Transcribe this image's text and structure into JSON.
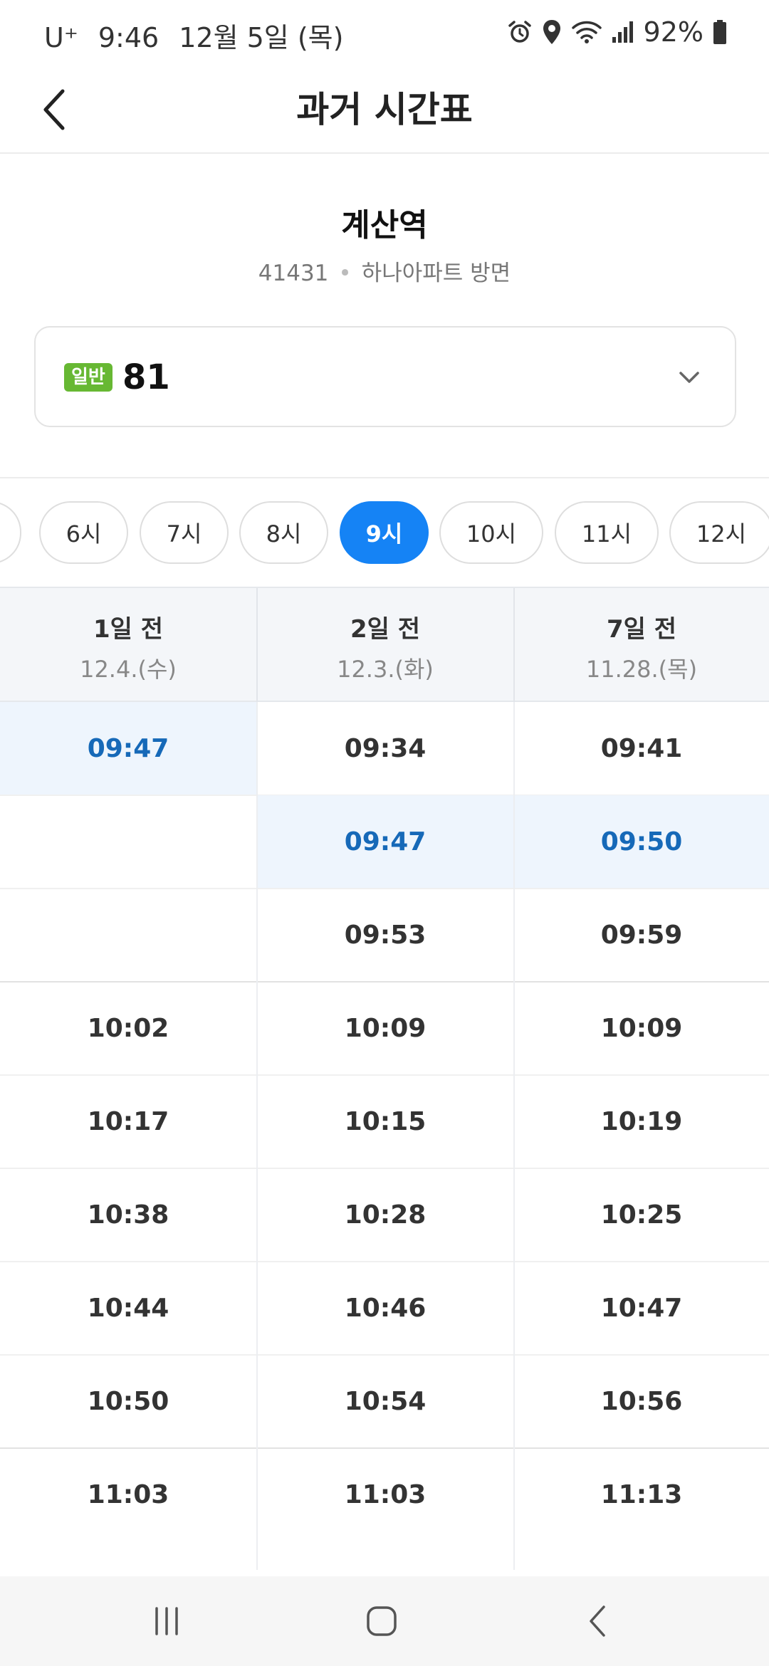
{
  "status_bar": {
    "carrier": "U⁺",
    "time": "9:46",
    "date": "12월 5일 (목)",
    "battery": "92%",
    "icons": [
      "alarm-icon",
      "location-icon",
      "wifi-icon",
      "signal-icon",
      "battery-icon"
    ]
  },
  "header": {
    "title": "과거 시간표",
    "back_icon": "chevron-left-icon"
  },
  "stop": {
    "name": "계산역",
    "id": "41431",
    "direction": "하나아파트 방면"
  },
  "route": {
    "badge": "일반",
    "badge_color": "#67b833",
    "number": "81"
  },
  "hours": [
    {
      "label": "",
      "active": false
    },
    {
      "label": "6시",
      "active": false
    },
    {
      "label": "7시",
      "active": false
    },
    {
      "label": "8시",
      "active": false
    },
    {
      "label": "9시",
      "active": true
    },
    {
      "label": "10시",
      "active": false
    },
    {
      "label": "11시",
      "active": false
    },
    {
      "label": "12시",
      "active": false
    }
  ],
  "accent_color": "#1583f5",
  "highlight_text_color": "#1669b8",
  "table": {
    "columns": [
      {
        "title": "1일 전",
        "date": "12.4.(수)"
      },
      {
        "title": "2일 전",
        "date": "12.3.(화)"
      },
      {
        "title": "7일 전",
        "date": "11.28.(목)"
      }
    ],
    "rows": [
      [
        "09:47",
        "09:34",
        "09:41"
      ],
      [
        "",
        "09:47",
        "09:50"
      ],
      [
        "",
        "09:53",
        "09:59"
      ],
      [
        "10:02",
        "10:09",
        "10:09"
      ],
      [
        "10:17",
        "10:15",
        "10:19"
      ],
      [
        "10:38",
        "10:28",
        "10:25"
      ],
      [
        "10:44",
        "10:46",
        "10:47"
      ],
      [
        "10:50",
        "10:54",
        "10:56"
      ],
      [
        "11:03",
        "11:03",
        "11:13"
      ]
    ],
    "highlighted": [
      [
        0,
        0
      ],
      [
        1,
        1
      ],
      [
        1,
        2
      ]
    ]
  },
  "nav_bar": {
    "icons": [
      "recent-apps-icon",
      "home-icon",
      "back-icon"
    ]
  }
}
